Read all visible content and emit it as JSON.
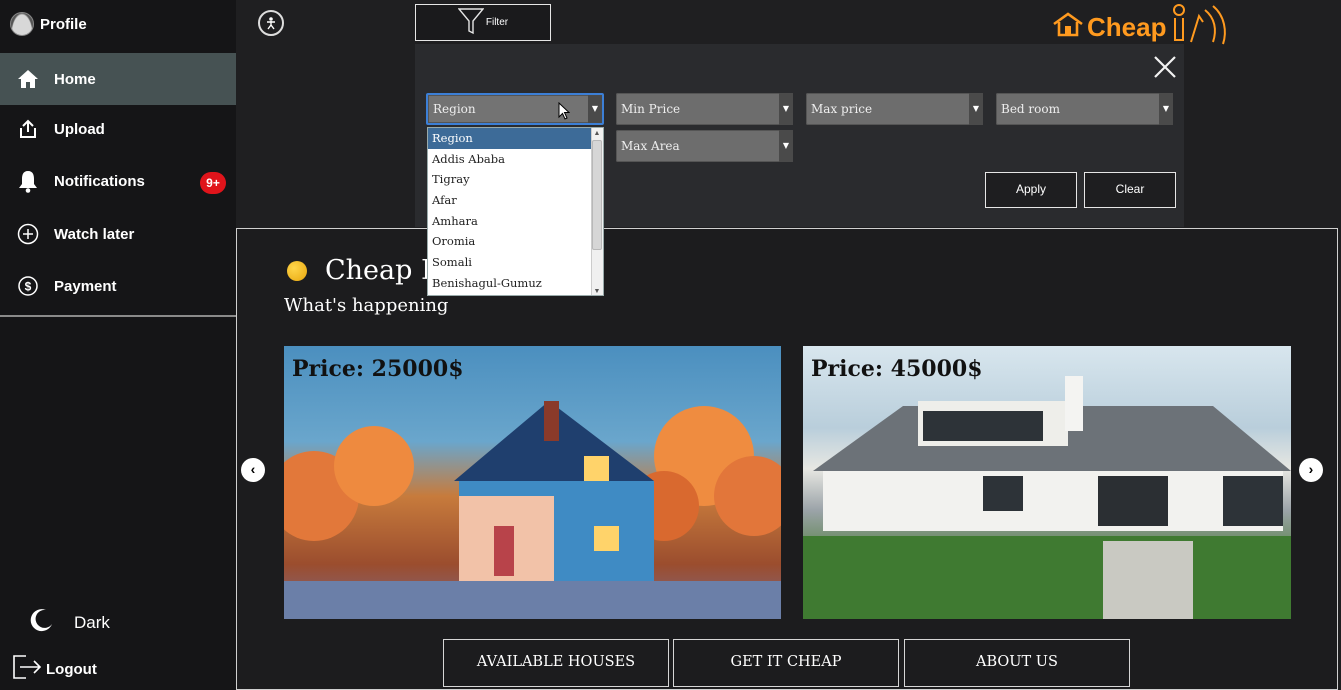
{
  "sidebar": {
    "profile_label": "Profile",
    "items": [
      {
        "label": "Home",
        "icon": "home-icon"
      },
      {
        "label": "Upload",
        "icon": "upload-icon"
      },
      {
        "label": "Notifications",
        "icon": "bell-icon",
        "badge": "9+"
      },
      {
        "label": "Watch later",
        "icon": "plus-circle-icon"
      },
      {
        "label": "Payment",
        "icon": "dollar-circle-icon"
      }
    ],
    "theme_label": "Dark",
    "logout_label": "Logout"
  },
  "topbar": {
    "filter_label": "Filter",
    "logo_text": "Cheap"
  },
  "filter": {
    "selects": {
      "region": "Region",
      "min_price": "Min Price",
      "max_price": "Max price",
      "bed_room": "Bed room",
      "max_area": "Max Area"
    },
    "apply_label": "Apply",
    "clear_label": "Clear",
    "region_options": [
      "Region",
      "Addis Ababa",
      "Tigray",
      "Afar",
      "Amhara",
      "Oromia",
      "Somali",
      "Benishagul-Gumuz"
    ],
    "region_selected": "Region"
  },
  "main": {
    "title": "Cheap H",
    "subtitle": "What's happening",
    "cards": [
      {
        "price": "Price: 25000$"
      },
      {
        "price": "Price: 45000$"
      }
    ],
    "buttons": [
      "AVAILABLE HOUSES",
      "GET IT CHEAP",
      "ABOUT US"
    ]
  },
  "colors": {
    "brand": "#ff9a1f",
    "active_nav": "#465253",
    "badge": "#e0141b"
  }
}
